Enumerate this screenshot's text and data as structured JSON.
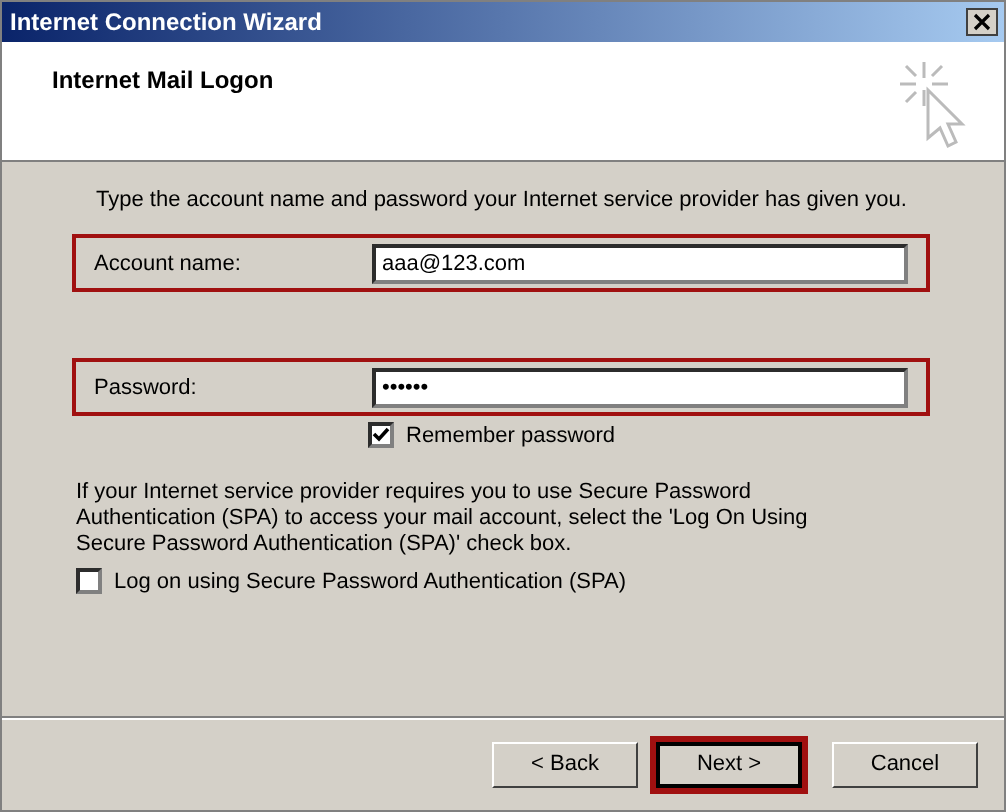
{
  "window": {
    "title": "Internet Connection Wizard"
  },
  "header": {
    "title": "Internet Mail Logon"
  },
  "instruction": "Type the account name and password your Internet service provider has given you.",
  "account": {
    "label": "Account name:",
    "value": "aaa@123.com"
  },
  "password": {
    "label": "Password:",
    "value": "••••••"
  },
  "remember": {
    "label": "Remember password",
    "checked": true
  },
  "spa_note": "If your Internet service provider requires you to use Secure Password Authentication (SPA) to access your mail account, select the 'Log On Using Secure Password Authentication (SPA)' check box.",
  "spa": {
    "label": "Log on using Secure Password Authentication (SPA)",
    "checked": false
  },
  "buttons": [
    {
      "label": "< Back",
      "selected": false
    },
    {
      "label": "Next >",
      "selected": true
    },
    {
      "label": "Cancel",
      "selected": false
    }
  ]
}
